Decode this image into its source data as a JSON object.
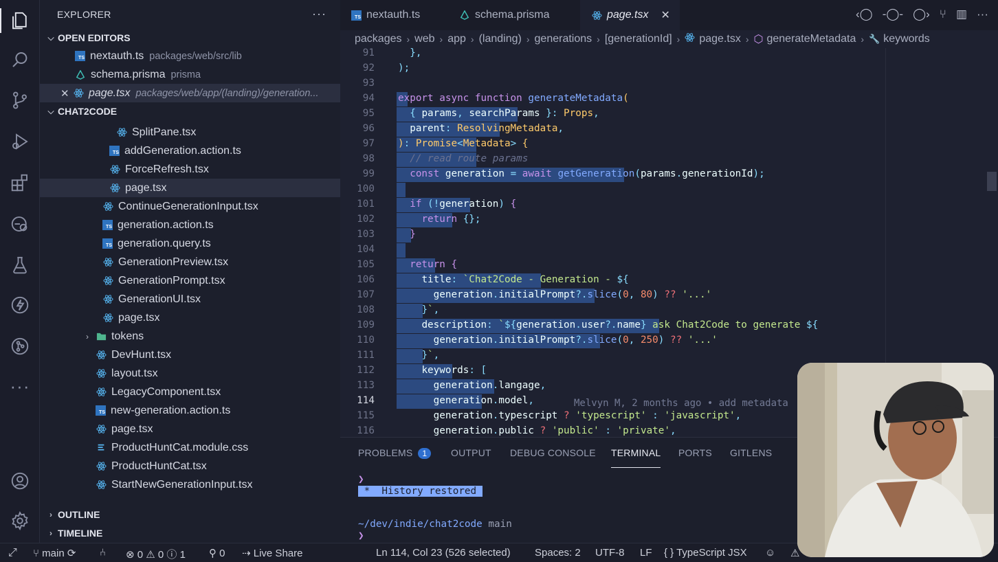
{
  "activity": {
    "icons": [
      "explorer-icon",
      "search-icon",
      "source-control-icon",
      "run-debug-icon",
      "extensions-icon",
      "remote-explorer-icon",
      "testing-icon",
      "thunder-client-icon",
      "gitlens-icon",
      "more-icon",
      "account-icon",
      "settings-gear-icon"
    ]
  },
  "sidebar": {
    "title": "EXPLORER",
    "more": "···",
    "open_editors": {
      "label": "OPEN EDITORS",
      "items": [
        {
          "name": "nextauth.ts",
          "path": "packages/web/src/lib"
        },
        {
          "name": "schema.prisma",
          "path": "prisma"
        },
        {
          "name": "page.tsx",
          "path": "packages/web/app/(landing)/generation..."
        }
      ]
    },
    "project": {
      "label": "CHAT2CODE",
      "files": [
        "SplitPane.tsx",
        "addGeneration.action.ts",
        "ForceRefresh.tsx",
        "page.tsx",
        "ContinueGenerationInput.tsx",
        "generation.action.ts",
        "generation.query.ts",
        "GenerationPreview.tsx",
        "GenerationPrompt.tsx",
        "GenerationUI.tsx",
        "page.tsx",
        "tokens",
        "DevHunt.tsx",
        "layout.tsx",
        "LegacyComponent.tsx",
        "new-generation.action.ts",
        "page.tsx",
        "ProductHuntCat.module.css",
        "ProductHuntCat.tsx",
        "StartNewGenerationInput.tsx"
      ]
    },
    "outline": "OUTLINE",
    "timeline": "TIMELINE"
  },
  "tabs": [
    {
      "label": "nextauth.ts"
    },
    {
      "label": "schema.prisma"
    },
    {
      "label": "page.tsx",
      "close": "✕"
    }
  ],
  "breadcrumb": [
    "packages",
    "web",
    "app",
    "(landing)",
    "generations",
    "[generationId]",
    "page.tsx",
    "generateMetadata",
    "keywords"
  ],
  "code": {
    "line_numbers": [
      "91",
      "92",
      "93",
      "94",
      "95",
      "96",
      "97",
      "98",
      "99",
      "100",
      "101",
      "102",
      "103",
      "104",
      "105",
      "106",
      "107",
      "108",
      "109",
      "110",
      "111",
      "112",
      "113",
      "114",
      "115",
      "116"
    ],
    "current_line": "114",
    "blame": "Melvyn M, 2 months ago • add metadata"
  },
  "panel": {
    "tabs": [
      "PROBLEMS",
      "OUTPUT",
      "DEBUG CONSOLE",
      "TERMINAL",
      "PORTS",
      "GITLENS"
    ],
    "problems_count": "1",
    "terminal": {
      "prompt1": "❯",
      "history": " *  History restored ",
      "cwd": "~/dev/indie/chat2code",
      "branch": "main",
      "prompt2": "❯"
    }
  },
  "status": {
    "branch": "main",
    "errors": "0",
    "warnings": "0",
    "info": "1",
    "ports": "0",
    "live_share": "Live Share",
    "position": "Ln 114, Col 23 (526 selected)",
    "spaces": "Spaces: 2",
    "encoding": "UTF-8",
    "eol": "LF",
    "language": "TypeScript JSX"
  },
  "colors": {
    "accent": "#2f6fcf",
    "selection": "#2c4a80"
  }
}
